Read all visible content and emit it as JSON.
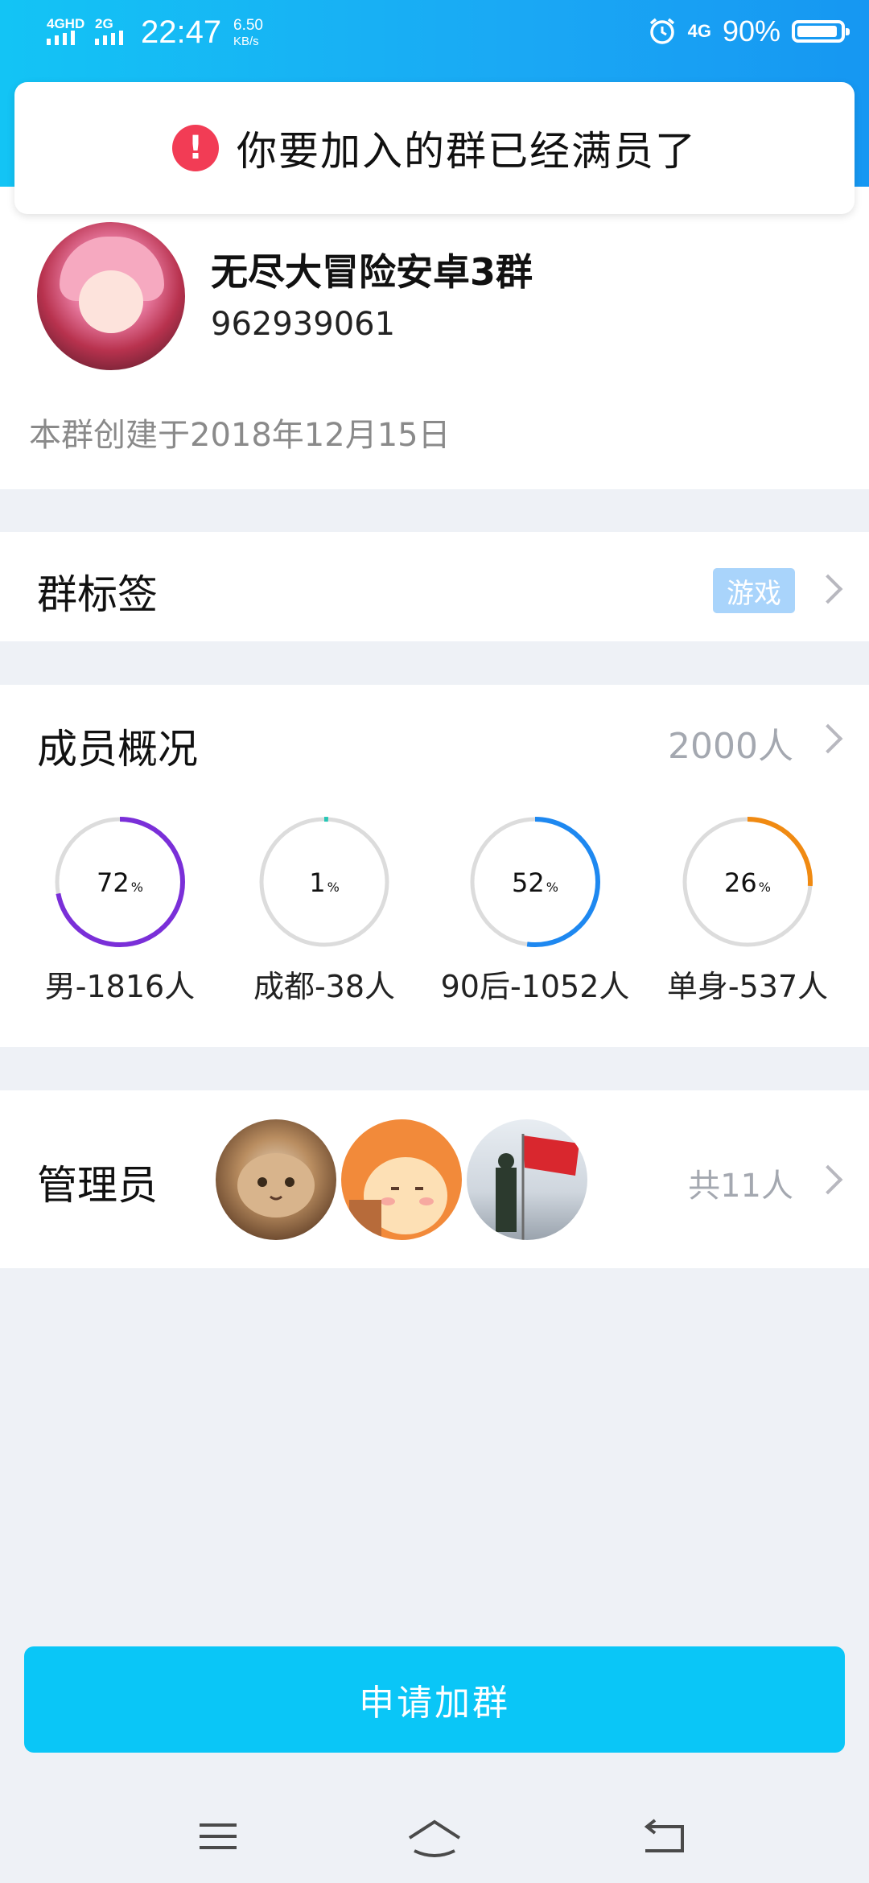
{
  "status_bar": {
    "net1": "4GHD",
    "net2": "2G",
    "time": "22:47",
    "speed_value": "6.50",
    "speed_unit": "KB/s",
    "net_right": "4G",
    "battery": "90%"
  },
  "toast": {
    "icon": "alert-circle-icon",
    "text": "你要加入的群已经满员了"
  },
  "group": {
    "name": "无尽大冒险安卓3群",
    "id": "962939061",
    "created": "本群创建于2018年12月15日"
  },
  "tags": {
    "title": "群标签",
    "badge": "游戏"
  },
  "members": {
    "title": "成员概况",
    "count": "2000人",
    "stats": [
      {
        "value": "72",
        "percent": 72,
        "label": "男-1816人",
        "color": "#7a2fd8"
      },
      {
        "value": "1",
        "percent": 1,
        "label": "成都-38人",
        "color": "#26c6b5"
      },
      {
        "value": "52",
        "percent": 52,
        "label": "90后-1052人",
        "color": "#1e88f0"
      },
      {
        "value": "26",
        "percent": 26,
        "label": "单身-537人",
        "color": "#f08a12"
      }
    ],
    "pct_sign": "%"
  },
  "admins": {
    "title": "管理员",
    "total": "共11人",
    "avatars": [
      "cat-avatar",
      "cartoon-avatar",
      "flag-avatar"
    ]
  },
  "apply_button": "申请加群",
  "colors": {
    "accent": "#0ac6f7",
    "header": "#13c4f5",
    "alert": "#f23c55"
  }
}
